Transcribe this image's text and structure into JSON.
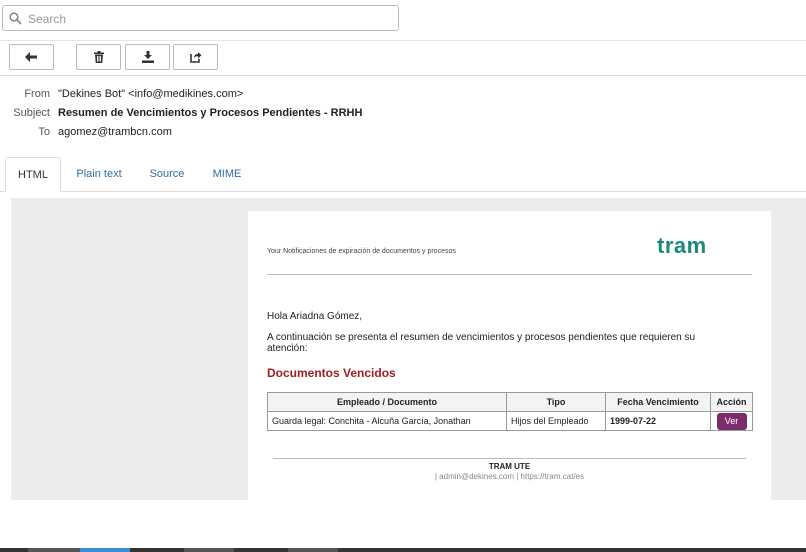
{
  "search": {
    "placeholder": "Search"
  },
  "toolbar": {
    "buttons": [
      {
        "name": "back-button",
        "icon": "arrow-left-icon"
      },
      {
        "name": "delete-button",
        "icon": "trash-icon"
      },
      {
        "name": "download-button",
        "icon": "download-icon"
      },
      {
        "name": "open-external-button",
        "icon": "external-link-icon"
      }
    ]
  },
  "headers": {
    "from_label": "From",
    "from_value": "\"Dekines Bot\" <info@medikines.com>",
    "subject_label": "Subject",
    "subject_value": "Resumen de Vencimientos y Procesos Pendientes - RRHH",
    "to_label": "To",
    "to_value": "agomez@trambcn.com"
  },
  "tabs": [
    "HTML",
    "Plain text",
    "Source",
    "MIME"
  ],
  "email": {
    "notification_line": "Your Notificaciones de expiración de documentos y procesos",
    "logo": "tram",
    "greeting": "Hola Ariadna Gómez,",
    "intro": "A continuación se presenta el resumen de vencimientos y procesos pendientes que requieren su atención:",
    "section_title": "Documentos Vencidos",
    "table": {
      "headers": [
        "Empleado / Documento",
        "Tipo",
        "Fecha Vencimiento",
        "Acción"
      ],
      "rows": [
        {
          "documento": "Guarda legal: Conchita - Alcuña García, Jonathan",
          "tipo": "Hijos del Empleado",
          "fecha": "1999-07-22",
          "accion": "Ver"
        }
      ]
    },
    "footer_title": "TRAM UTE",
    "footer_links": "| admin@dekines.com | https://tram.cat/es"
  },
  "colors": {
    "accent_red": "#a31d22",
    "date_red": "#e02020",
    "button_purple": "#7b2d6b",
    "logo_teal": "#1a8a7a",
    "link_blue": "#2c6ea4"
  }
}
